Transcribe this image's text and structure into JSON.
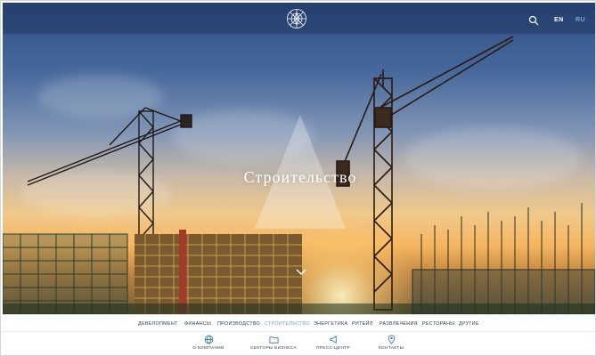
{
  "header": {
    "lang_en": "EN",
    "lang_ru": "RU",
    "search_icon": "search-icon",
    "logo_icon": "snowflake-mandala-logo"
  },
  "hero": {
    "title": "Строительство",
    "scroll_icon": "chevron-down-icon"
  },
  "nav": {
    "items": [
      {
        "label": "Девелопмент",
        "active": false
      },
      {
        "label": "Финансы",
        "active": false
      },
      {
        "label": "Производство",
        "active": false
      },
      {
        "label": "Строительство",
        "active": true
      },
      {
        "label": "Энергетика",
        "active": false
      },
      {
        "label": "Ритейл",
        "active": false
      },
      {
        "label": "Развлечения",
        "active": false
      },
      {
        "label": "Рестораны",
        "active": false
      },
      {
        "label": "Другие",
        "active": false
      }
    ],
    "active_color": "#6fa5c9"
  },
  "footer_nav": {
    "items": [
      {
        "label": "О компании",
        "icon": "globe-icon"
      },
      {
        "label": "Секторы бизнеса",
        "icon": "folder-icon"
      },
      {
        "label": "Пресс-центр",
        "icon": "megaphone-icon"
      },
      {
        "label": "Контакты",
        "icon": "map-pin-icon"
      }
    ]
  },
  "colors": {
    "accent": "#6fa5c9",
    "text": "#2c3e50"
  }
}
